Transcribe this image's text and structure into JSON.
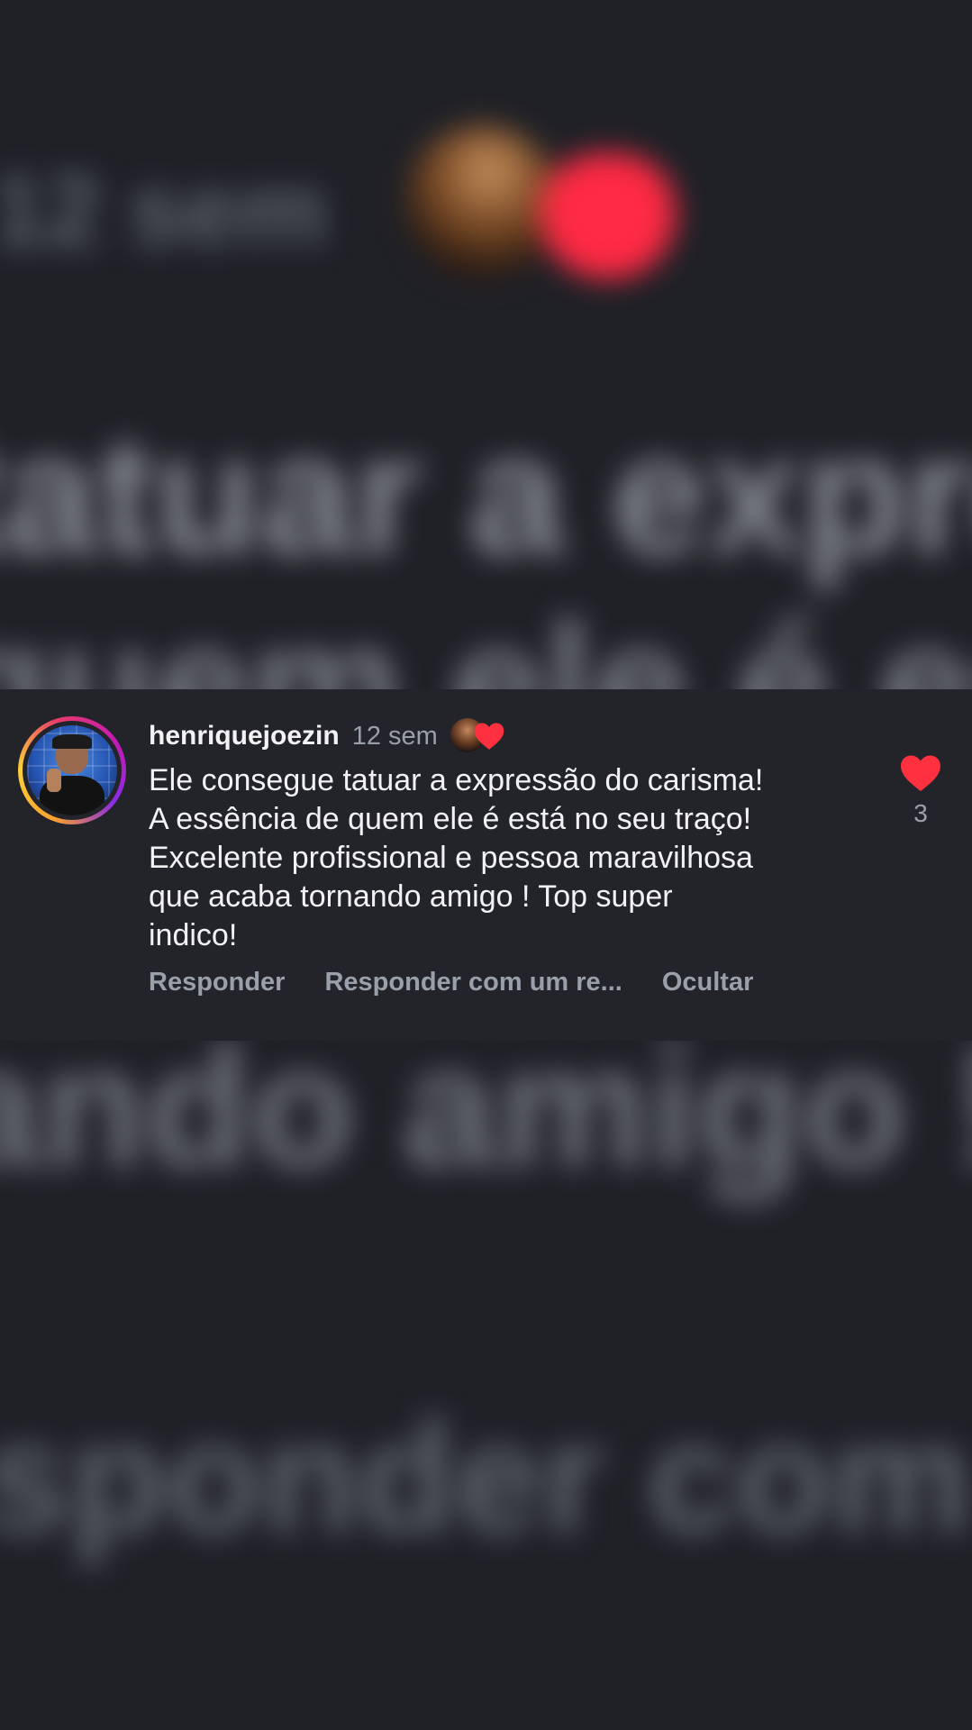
{
  "comment": {
    "username": "henriquejoezin",
    "time": "12 sem",
    "text": "Ele consegue tatuar a expressão do carisma!\nA essência de quem ele é está no seu traço!\nExcelente profissional e pessoa maravilhosa\nque acaba tornando amigo ! Top super\nindico!",
    "like_count": "3",
    "actions": {
      "reply": "Responder",
      "reply_with": "Responder com um re...",
      "hide": "Ocultar"
    }
  },
  "colors": {
    "background": "#202127",
    "card": "#23242a",
    "primary_text": "#f2f2f4",
    "secondary_text": "#9aa0aa",
    "heart_red": "#ff3040"
  }
}
